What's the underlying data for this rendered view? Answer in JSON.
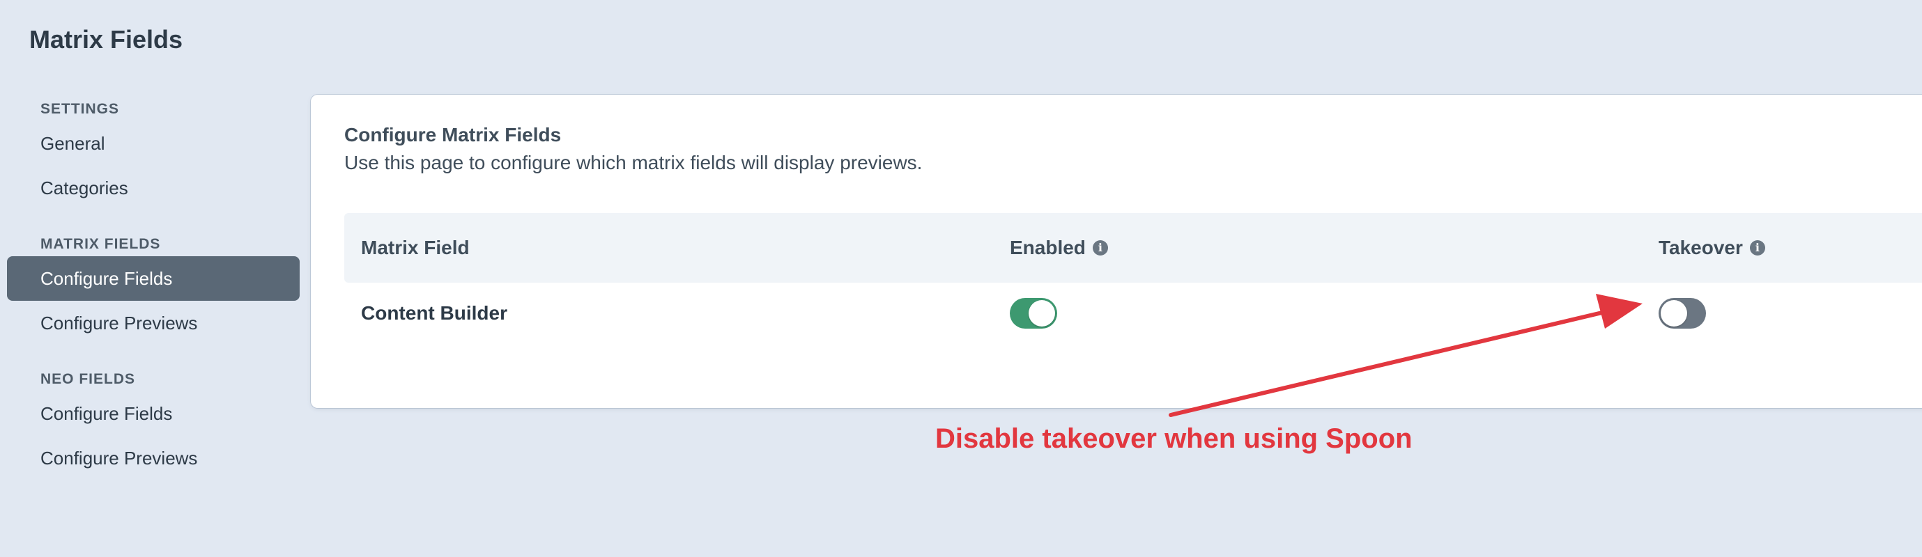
{
  "page": {
    "title": "Matrix Fields"
  },
  "sidebar": {
    "sections": [
      {
        "heading": "SETTINGS",
        "items": [
          "General",
          "Categories"
        ]
      },
      {
        "heading": "MATRIX FIELDS",
        "items": [
          "Configure Fields",
          "Configure Previews"
        ]
      },
      {
        "heading": "NEO FIELDS",
        "items": [
          "Configure Fields",
          "Configure Previews"
        ]
      }
    ],
    "active_item": "MATRIX FIELDS / Configure Fields"
  },
  "card": {
    "title": "Configure Matrix Fields",
    "description": "Use this page to configure which matrix fields will display previews.",
    "table": {
      "columns": [
        "Matrix Field",
        "Enabled",
        "Takeover"
      ],
      "info_icon": "info-icon",
      "rows": [
        {
          "field": "Content Builder",
          "enabled": true,
          "takeover": false
        }
      ]
    }
  },
  "annotation": {
    "text": "Disable takeover when using Spoon",
    "color": "#e2373f"
  },
  "colors": {
    "toggle_on": "#3d9970",
    "toggle_off": "#6b7682",
    "sidebar_active": "#5a6876",
    "background": "#e1e8f2"
  }
}
